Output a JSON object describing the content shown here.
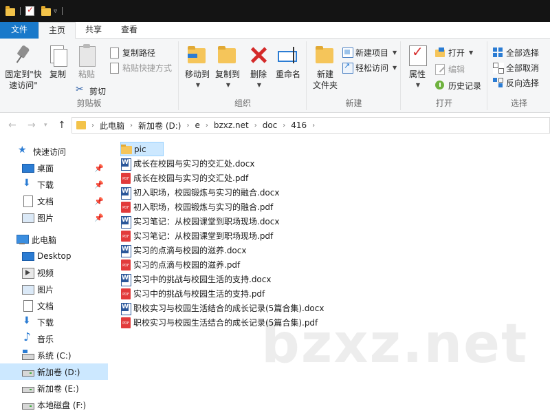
{
  "tabs": [
    {
      "label": "文件"
    },
    {
      "label": "主页"
    },
    {
      "label": "共享"
    },
    {
      "label": "查看"
    }
  ],
  "ribbon": {
    "clipboard": {
      "group_label": "剪贴板",
      "pin_label_1": "固定到\"快",
      "pin_label_2": "速访问\"",
      "copy_label": "复制",
      "paste_label": "粘贴",
      "copy_path_label": "复制路径",
      "paste_shortcut_label": "粘贴快捷方式",
      "cut_label": "剪切"
    },
    "organize": {
      "group_label": "组织",
      "move_to_label": "移动到",
      "copy_to_label": "复制到",
      "delete_label": "删除",
      "rename_label": "重命名"
    },
    "new": {
      "group_label": "新建",
      "new_folder_label_1": "新建",
      "new_folder_label_2": "文件夹",
      "new_item_label": "新建项目",
      "easy_access_label": "轻松访问"
    },
    "open": {
      "group_label": "打开",
      "properties_label": "属性",
      "open_label": "打开",
      "edit_label": "编辑",
      "history_label": "历史记录"
    },
    "select": {
      "group_label": "选择",
      "select_all_label": "全部选择",
      "select_none_label": "全部取消",
      "invert_label": "反向选择"
    }
  },
  "address": {
    "crumbs": [
      "此电脑",
      "新加卷 (D:)",
      "e",
      "bzxz.net",
      "doc",
      "416"
    ]
  },
  "sidebar": {
    "items": [
      {
        "label": "快速访问",
        "icon": "star-icon"
      },
      {
        "label": "桌面",
        "icon": "desktop-icon"
      },
      {
        "label": "下载",
        "icon": "download-icon"
      },
      {
        "label": "文档",
        "icon": "documents-icon"
      },
      {
        "label": "图片",
        "icon": "pictures-icon"
      },
      {
        "label": "此电脑",
        "icon": "computer-icon"
      },
      {
        "label": "Desktop",
        "icon": "desktop-icon"
      },
      {
        "label": "视频",
        "icon": "video-icon"
      },
      {
        "label": "图片",
        "icon": "pictures-icon"
      },
      {
        "label": "文档",
        "icon": "documents-icon"
      },
      {
        "label": "下载",
        "icon": "download-icon"
      },
      {
        "label": "音乐",
        "icon": "music-icon"
      },
      {
        "label": "系统 (C:)",
        "icon": "system-drive-icon"
      },
      {
        "label": "新加卷 (D:)",
        "icon": "drive-icon"
      },
      {
        "label": "新加卷 (E:)",
        "icon": "drive-icon"
      },
      {
        "label": "本地磁盘 (F:)",
        "icon": "drive-icon"
      }
    ]
  },
  "files": [
    {
      "name": "pic",
      "type": "folder"
    },
    {
      "name": "成长在校园与实习的交汇处.docx",
      "type": "docx"
    },
    {
      "name": "成长在校园与实习的交汇处.pdf",
      "type": "pdf"
    },
    {
      "name": "初入职场，校园锻炼与实习的融合.docx",
      "type": "docx"
    },
    {
      "name": "初入职场，校园锻炼与实习的融合.pdf",
      "type": "pdf"
    },
    {
      "name": "实习笔记：从校园课堂到职场现场.docx",
      "type": "docx"
    },
    {
      "name": "实习笔记：从校园课堂到职场现场.pdf",
      "type": "pdf"
    },
    {
      "name": "实习的点滴与校园的滋养.docx",
      "type": "docx"
    },
    {
      "name": "实习的点滴与校园的滋养.pdf",
      "type": "pdf"
    },
    {
      "name": "实习中的挑战与校园生活的支持.docx",
      "type": "docx"
    },
    {
      "name": "实习中的挑战与校园生活的支持.pdf",
      "type": "pdf"
    },
    {
      "name": "职校实习与校园生活结合的成长记录(5篇合集).docx",
      "type": "docx"
    },
    {
      "name": "职校实习与校园生活结合的成长记录(5篇合集).pdf",
      "type": "pdf"
    }
  ],
  "watermark": "bzxz.net",
  "colors": {
    "accent": "#1979ca",
    "selection": "#cce8ff",
    "ribbon_bg": "#f5f6f7",
    "titlebar": "#141414"
  }
}
